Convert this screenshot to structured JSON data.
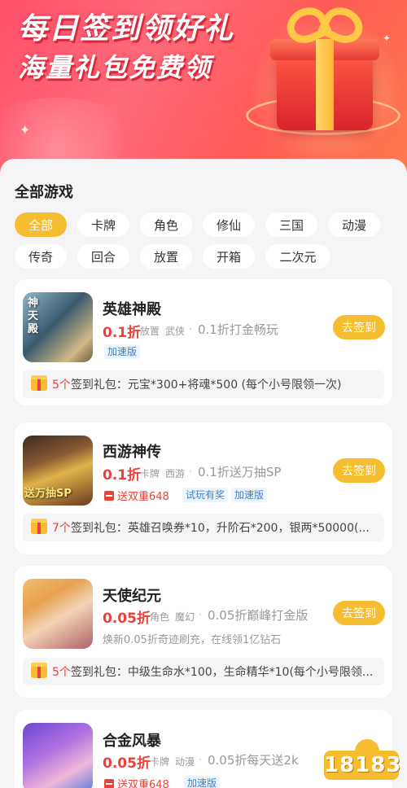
{
  "banner": {
    "title_line1": "每日签到领好礼",
    "title_line2": "海量礼包免费领"
  },
  "section_title": "全部游戏",
  "categories": [
    "全部",
    "卡牌",
    "角色",
    "修仙",
    "三国",
    "动漫",
    "传奇",
    "回合",
    "放置",
    "开箱",
    "二次元"
  ],
  "active_category": "全部",
  "sign_button_label": "去签到",
  "games": [
    {
      "name": "英雄神殿",
      "thumb_text": "神天殿",
      "discount": "0.1折",
      "genres": [
        "放置",
        "武侠"
      ],
      "desc": "0.1折打金畅玩",
      "tags": [
        "加速版"
      ],
      "gift_count": "5个",
      "gift_label": "签到礼包：",
      "gift_text": "元宝*300+将魂*500 (每个小号限领一次)"
    },
    {
      "name": "西游神传",
      "thumb_text": "送万抽SP",
      "discount": "0.1折",
      "genres": [
        "卡牌",
        "西游"
      ],
      "desc": "0.1折送万抽SP",
      "promo": "送双重648",
      "tags": [
        "试玩有奖",
        "加速版"
      ],
      "gift_count": "7个",
      "gift_label": "签到礼包：",
      "gift_text": "英雄召唤券*10，升阶石*200，银两*50000(..."
    },
    {
      "name": "天使纪元",
      "discount": "0.05折",
      "genres": [
        "角色",
        "魔幻"
      ],
      "desc": "0.05折巅峰打金版",
      "note": "焕新0.05折奇迹刷充，在线领1亿钻石",
      "gift_count": "5个",
      "gift_label": "签到礼包：",
      "gift_text": "中级生命水*100，生命精华*10(每个小号限领..."
    },
    {
      "name": "合金风暴",
      "discount": "0.05折",
      "genres": [
        "卡牌",
        "动漫"
      ],
      "desc": "0.05折每天送2k",
      "promo": "送双重648",
      "tags": [
        "加速版"
      ]
    }
  ],
  "watermark": "18183",
  "colors": {
    "accent": "#f6bd30",
    "discount_red": "#e8423a",
    "tag_blue": "#3d82c9",
    "banner_red": "#ff5a62"
  },
  "icons": [
    "gift-box-icon",
    "red-packet-icon",
    "sparkle-icon"
  ]
}
